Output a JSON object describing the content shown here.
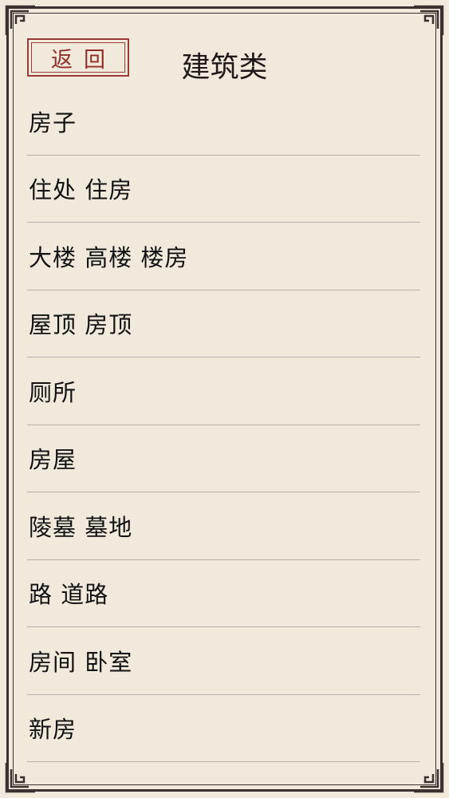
{
  "header": {
    "back_label": "返回",
    "title": "建筑类"
  },
  "items": [
    {
      "label": "房子"
    },
    {
      "label": "住处 住房"
    },
    {
      "label": "大楼 高楼 楼房"
    },
    {
      "label": "屋顶 房顶"
    },
    {
      "label": "厕所"
    },
    {
      "label": "房屋"
    },
    {
      "label": "陵墓 墓地"
    },
    {
      "label": "路 道路"
    },
    {
      "label": "房间 卧室"
    },
    {
      "label": "新房"
    }
  ],
  "colors": {
    "background": "#f1e9db",
    "frame": "#3a3230",
    "accent_red": "#9a3b35",
    "divider": "#b8b2ac",
    "text": "#111111"
  },
  "icons": [
    "corner-ornament-icon"
  ]
}
